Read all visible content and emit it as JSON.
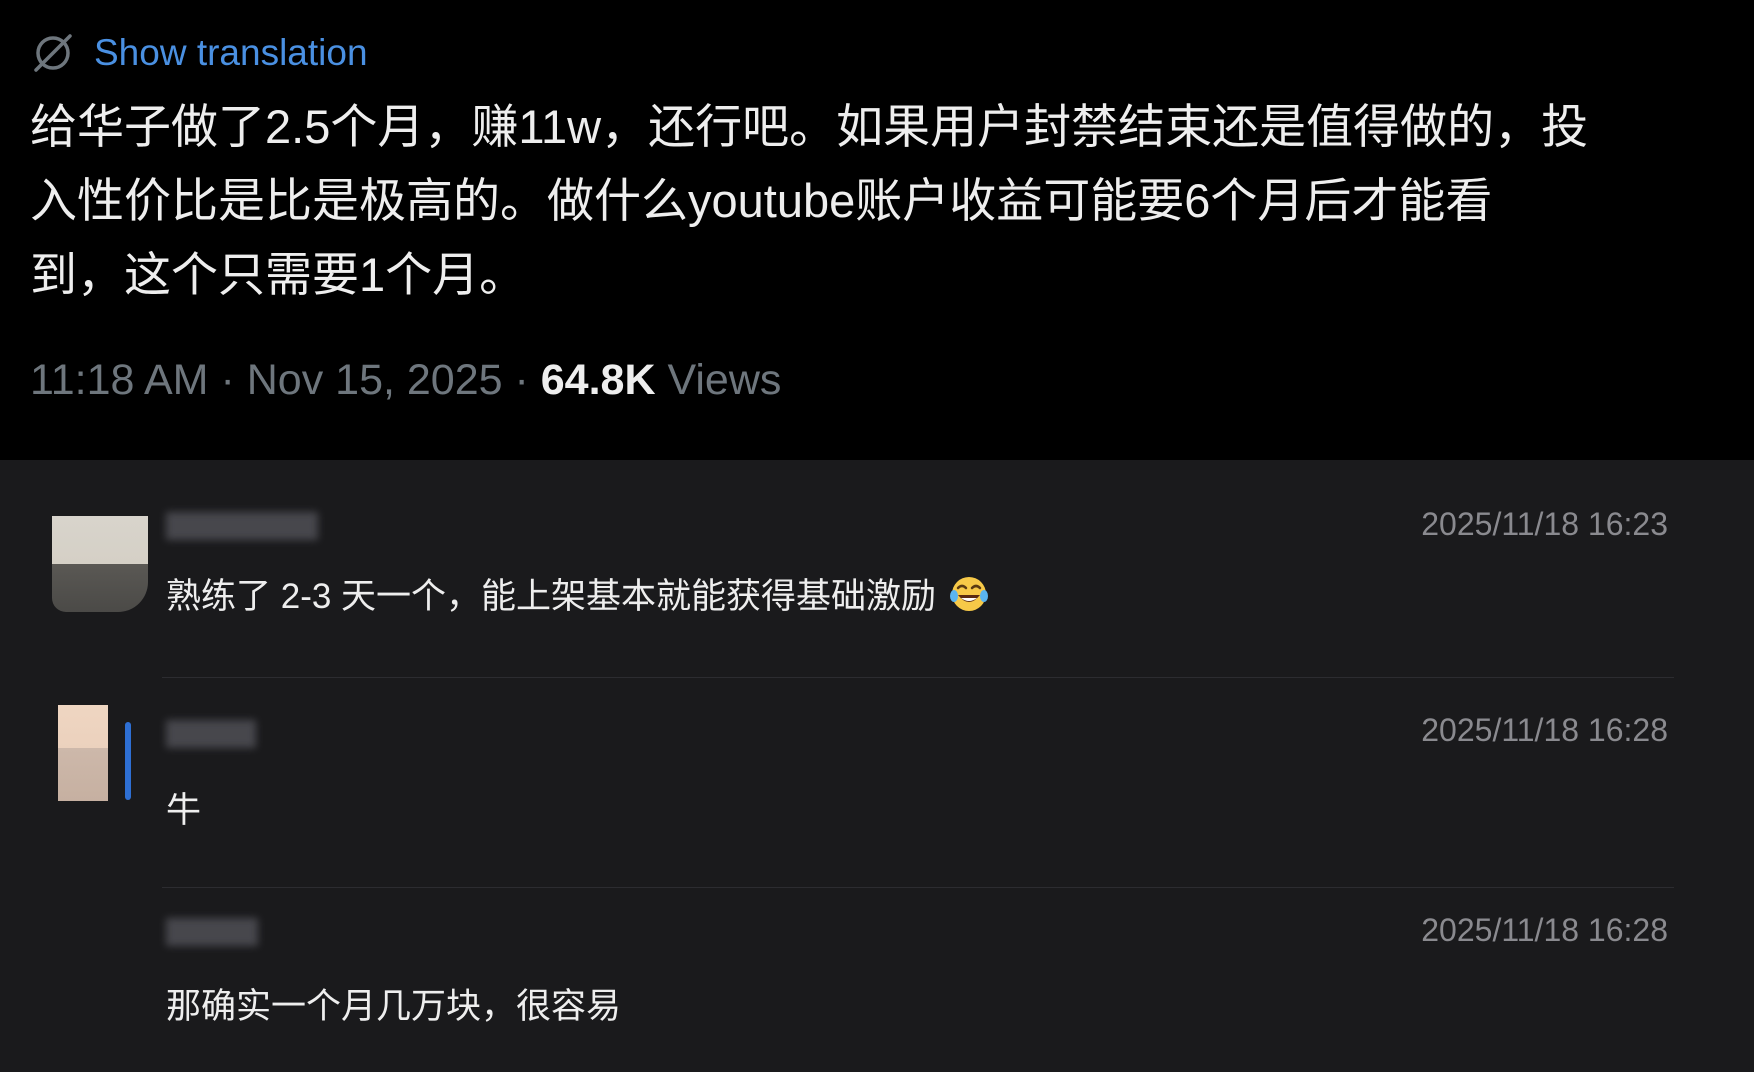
{
  "tweet": {
    "translate_label": "Show translation",
    "text": "给华子做了2.5个月，赚11w，还行吧。如果用户封禁结束还是值得做的，投\n入性价比是比是极高的。做什么youtube账户收益可能要6个月后才能看\n到，这个只需要1个月。",
    "time": "11:18 AM",
    "date": "Nov 15, 2025",
    "views_count": "64.8K",
    "views_label": "Views"
  },
  "comments": [
    {
      "timestamp": "2025/11/18 16:23",
      "text": "熟练了 2-3 天一个，能上架基本就能获得基础激励",
      "emoji": "face-with-tears-of-joy-icon"
    },
    {
      "timestamp": "2025/11/18 16:28",
      "text": "牛"
    },
    {
      "timestamp": "2025/11/18 16:28",
      "text": "那确实一个月几万块，很容易"
    }
  ],
  "colors": {
    "accent": "#4a90e2",
    "background_top": "#000000",
    "background_comments": "#1a1a1c"
  }
}
